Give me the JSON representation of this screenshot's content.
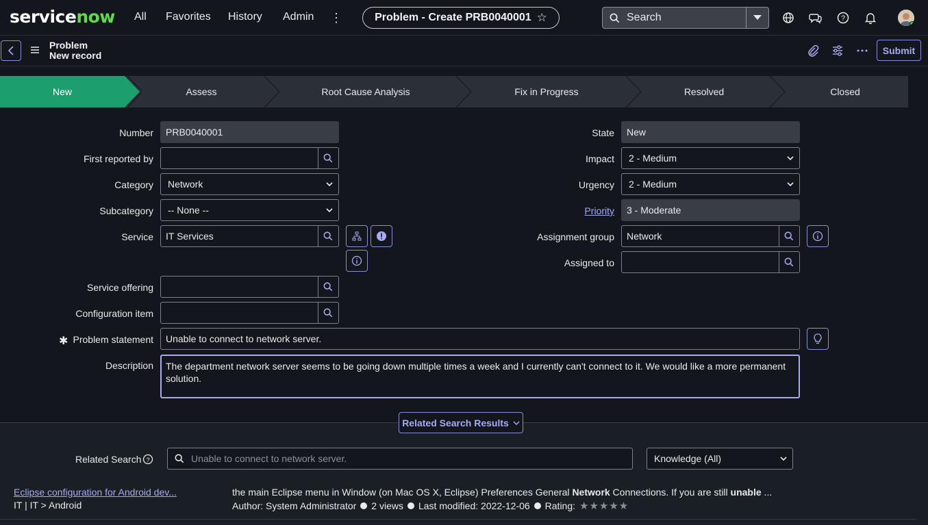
{
  "nav": {
    "logo_left": "service",
    "logo_right": "now",
    "links": [
      "All",
      "Favorites",
      "History",
      "Admin"
    ],
    "more_label": "⋮",
    "title": "Problem - Create PRB0040001",
    "search_placeholder": "Search"
  },
  "record": {
    "table": "Problem",
    "subtitle": "New record",
    "submit_label": "Submit"
  },
  "flow": {
    "steps": [
      "New",
      "Assess",
      "Root Cause Analysis",
      "Fix in Progress",
      "Resolved",
      "Closed"
    ],
    "active_index": 0,
    "active_color": "#1c9e6f"
  },
  "form": {
    "number_label": "Number",
    "number_value": "PRB0040001",
    "first_reported_label": "First reported by",
    "first_reported_value": "",
    "category_label": "Category",
    "category_value": "Network",
    "subcategory_label": "Subcategory",
    "subcategory_value": "-- None --",
    "service_label": "Service",
    "service_value": "IT Services",
    "service_offering_label": "Service offering",
    "service_offering_value": "",
    "config_item_label": "Configuration item",
    "config_item_value": "",
    "problem_statement_label": "Problem statement",
    "problem_statement_required": "✱",
    "problem_statement_value": "Unable to connect to network server.",
    "description_label": "Description",
    "description_value": "The department network server seems to be going down multiple times a week and I currently can't connect to it. We would like a more permanent solution.",
    "state_label": "State",
    "state_value": "New",
    "impact_label": "Impact",
    "impact_value": "2 - Medium",
    "urgency_label": "Urgency",
    "urgency_value": "2 - Medium",
    "priority_label": "Priority",
    "priority_value": "3 - Moderate",
    "assignment_group_label": "Assignment group",
    "assignment_group_value": "Network",
    "assigned_to_label": "Assigned to",
    "assigned_to_value": ""
  },
  "related": {
    "toggle_label": "Related Search Results",
    "search_label": "Related Search",
    "search_value": "Unable to connect to network server.",
    "source_value": "Knowledge (All)",
    "result": {
      "title": "Eclipse configuration for Android dev...",
      "path": "IT | IT > Android",
      "snippet_a": "the main Eclipse menu in Window (on Mac OS X, Eclipse) Preferences General ",
      "snippet_b1": "Network",
      "snippet_c": " Connections. If you are still ",
      "snippet_b2": "unable",
      "snippet_d": " ...",
      "author": "Author: System Administrator",
      "views": "2 views",
      "modified": "Last modified: 2022-12-06",
      "rating_label": "Rating:",
      "rating": 0,
      "rating_max": 5
    }
  },
  "colors": {
    "accent": "#a6abf2",
    "brand_green": "#62d84e",
    "background": "#13171d"
  }
}
